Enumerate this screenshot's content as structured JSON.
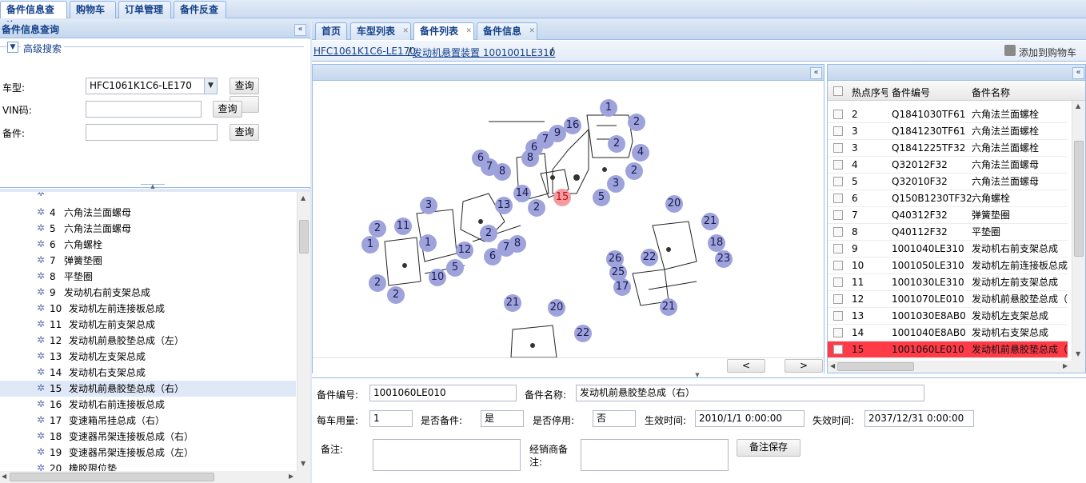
{
  "top_tabs": [
    "备件信息查询",
    "购物车",
    "订单管理",
    "备件反查"
  ],
  "left_panel": {
    "title": "备件信息查询",
    "advanced_search": "高级搜索",
    "car_label": "车型:",
    "car_value": "HFC1061K1C6-LE170",
    "query": "查询",
    "vin_label": "VIN码:",
    "vin_value": "",
    "part_label": "备件:",
    "part_value": "",
    "tree_items": [
      {
        "num": "4",
        "name": "六角法兰面螺母"
      },
      {
        "num": "5",
        "name": "六角法兰面螺母"
      },
      {
        "num": "6",
        "name": "六角螺栓"
      },
      {
        "num": "7",
        "name": "弹簧垫圈"
      },
      {
        "num": "8",
        "name": "平垫圈"
      },
      {
        "num": "9",
        "name": "发动机右前支架总成"
      },
      {
        "num": "10",
        "name": "发动机左前连接板总成"
      },
      {
        "num": "11",
        "name": "发动机左前支架总成"
      },
      {
        "num": "12",
        "name": "发动机前悬胶垫总成（左）"
      },
      {
        "num": "13",
        "name": "发动机左支架总成"
      },
      {
        "num": "14",
        "name": "发动机右支架总成"
      },
      {
        "num": "15",
        "name": "发动机前悬胶垫总成（右）"
      },
      {
        "num": "16",
        "name": "发动机右前连接板总成"
      },
      {
        "num": "17",
        "name": "变速箱吊挂总成（右）"
      },
      {
        "num": "18",
        "name": "变速器吊架连接板总成（右）"
      },
      {
        "num": "19",
        "name": "变速器吊架连接板总成（左）"
      },
      {
        "num": "20",
        "name": "橡胶限位垫"
      }
    ]
  },
  "content_tabs": [
    "首页",
    "车型列表",
    "备件列表",
    "备件信息"
  ],
  "breadcrumb": {
    "link1": "HFC1061K1C6-LE170",
    "sep1": "/",
    "link2": "发动机悬置装置 1001001LE310",
    "sep2": "/"
  },
  "add_cart": "添加到购物车",
  "nav": {
    "prev": "<",
    "next": ">"
  },
  "grid": {
    "headers": [
      "热点序号",
      "备件编号",
      "备件名称"
    ],
    "rows": [
      [
        "2",
        "Q1841030TF61",
        "六角法兰面螺栓"
      ],
      [
        "3",
        "Q1841230TF61",
        "六角法兰面螺栓"
      ],
      [
        "3",
        "Q1841225TF32",
        "六角法兰面螺栓"
      ],
      [
        "4",
        "Q32012F32",
        "六角法兰面螺母"
      ],
      [
        "5",
        "Q32010F32",
        "六角法兰面螺母"
      ],
      [
        "6",
        "Q150B1230TF32",
        "六角螺栓"
      ],
      [
        "7",
        "Q40312F32",
        "弹簧垫圈"
      ],
      [
        "8",
        "Q40112F32",
        "平垫圈"
      ],
      [
        "9",
        "1001040LE310",
        "发动机右前支架总成"
      ],
      [
        "10",
        "1001050LE310",
        "发动机左前连接板总成"
      ],
      [
        "11",
        "1001030LE310",
        "发动机左前支架总成"
      ],
      [
        "12",
        "1001070LE010",
        "发动机前悬胶垫总成（"
      ],
      [
        "13",
        "1001030E8AB0",
        "发动机左支架总成"
      ],
      [
        "14",
        "1001040E8AB0",
        "发动机右支架总成"
      ],
      [
        "15",
        "1001060LE010",
        "发动机前悬胶垫总成（"
      ]
    ]
  },
  "detail": {
    "code_label": "备件编号:",
    "code": "1001060LE010",
    "name_label": "备件名称:",
    "name": "发动机前悬胶垫总成（右）",
    "qty_label": "每车用量:",
    "qty": "1",
    "is_part_label": "是否备件:",
    "is_part": "是",
    "disabled_label": "是否停用:",
    "disabled": "否",
    "start_label": "生效时间:",
    "start": "2010/1/1 0:00:00",
    "end_label": "失效时间:",
    "end": "2037/12/31 0:00:00",
    "remark_label": "备注:",
    "dealer_label1": "经销商备",
    "dealer_label2": "注:",
    "save": "备注保存"
  },
  "diagram_numbers": [
    "1",
    "2",
    "2",
    "4",
    "2",
    "16",
    "9",
    "7",
    "6",
    "8",
    "6",
    "7",
    "8",
    "14",
    "15",
    "2",
    "5",
    "3",
    "3",
    "13",
    "2",
    "11",
    "1",
    "12",
    "2",
    "7",
    "6",
    "8",
    "1",
    "5",
    "2",
    "10",
    "2",
    "20",
    "21",
    "18",
    "22",
    "23",
    "26",
    "25",
    "17",
    "21",
    "21",
    "20",
    "22"
  ],
  "colors": {
    "accent": "#15428b",
    "highlight": "#ff3b47",
    "select": "#dfe8f6"
  }
}
